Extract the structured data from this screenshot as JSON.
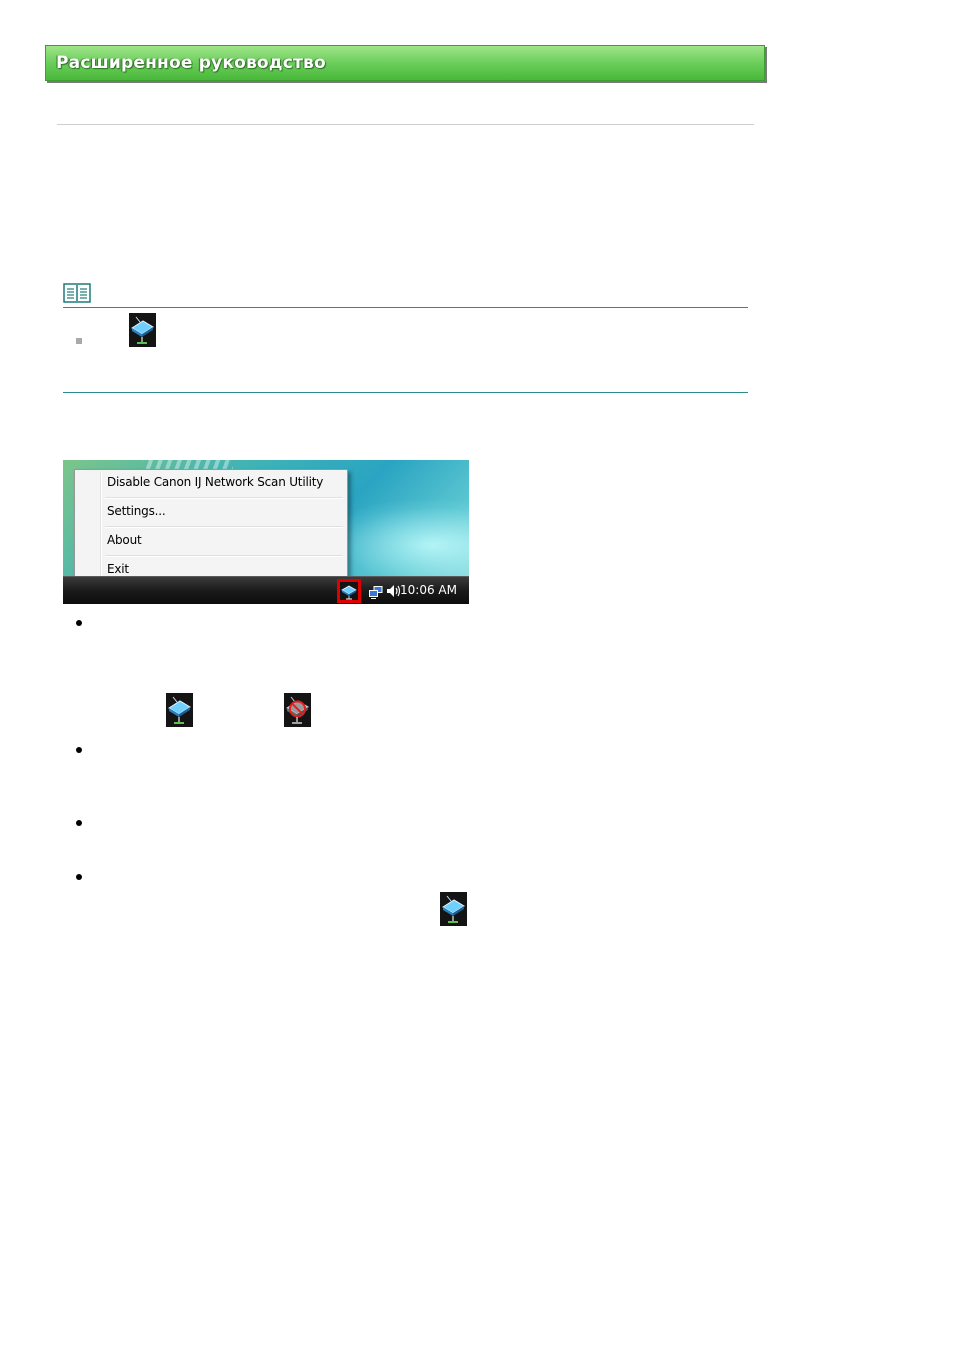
{
  "header": {
    "title": "Расширенное руководство"
  },
  "tray_menu": {
    "items": [
      {
        "label": "Disable Canon IJ Network Scan Utility"
      },
      {
        "label": "Settings..."
      },
      {
        "label": "About"
      },
      {
        "label": "Exit"
      }
    ],
    "clock": "10:06 AM"
  },
  "icons": {
    "note": "book-note-icon",
    "scanner_utility": "network-scan-utility-icon",
    "scanner_utility_disabled": "network-scan-utility-disabled-icon",
    "tray_network": "network-tray-icon",
    "tray_volume": "volume-tray-icon"
  },
  "colors": {
    "banner_green": "#5cc64b",
    "note_rule": "#2b8a8a",
    "highlight_red": "#e00000"
  }
}
